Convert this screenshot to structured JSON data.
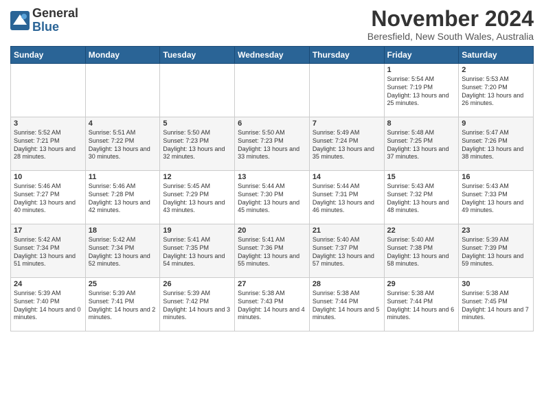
{
  "header": {
    "logo_general": "General",
    "logo_blue": "Blue",
    "month_title": "November 2024",
    "location": "Beresfield, New South Wales, Australia"
  },
  "weekdays": [
    "Sunday",
    "Monday",
    "Tuesday",
    "Wednesday",
    "Thursday",
    "Friday",
    "Saturday"
  ],
  "weeks": [
    [
      {
        "day": "",
        "content": ""
      },
      {
        "day": "",
        "content": ""
      },
      {
        "day": "",
        "content": ""
      },
      {
        "day": "",
        "content": ""
      },
      {
        "day": "",
        "content": ""
      },
      {
        "day": "1",
        "content": "Sunrise: 5:54 AM\nSunset: 7:19 PM\nDaylight: 13 hours and 25 minutes."
      },
      {
        "day": "2",
        "content": "Sunrise: 5:53 AM\nSunset: 7:20 PM\nDaylight: 13 hours and 26 minutes."
      }
    ],
    [
      {
        "day": "3",
        "content": "Sunrise: 5:52 AM\nSunset: 7:21 PM\nDaylight: 13 hours and 28 minutes."
      },
      {
        "day": "4",
        "content": "Sunrise: 5:51 AM\nSunset: 7:22 PM\nDaylight: 13 hours and 30 minutes."
      },
      {
        "day": "5",
        "content": "Sunrise: 5:50 AM\nSunset: 7:23 PM\nDaylight: 13 hours and 32 minutes."
      },
      {
        "day": "6",
        "content": "Sunrise: 5:50 AM\nSunset: 7:23 PM\nDaylight: 13 hours and 33 minutes."
      },
      {
        "day": "7",
        "content": "Sunrise: 5:49 AM\nSunset: 7:24 PM\nDaylight: 13 hours and 35 minutes."
      },
      {
        "day": "8",
        "content": "Sunrise: 5:48 AM\nSunset: 7:25 PM\nDaylight: 13 hours and 37 minutes."
      },
      {
        "day": "9",
        "content": "Sunrise: 5:47 AM\nSunset: 7:26 PM\nDaylight: 13 hours and 38 minutes."
      }
    ],
    [
      {
        "day": "10",
        "content": "Sunrise: 5:46 AM\nSunset: 7:27 PM\nDaylight: 13 hours and 40 minutes."
      },
      {
        "day": "11",
        "content": "Sunrise: 5:46 AM\nSunset: 7:28 PM\nDaylight: 13 hours and 42 minutes."
      },
      {
        "day": "12",
        "content": "Sunrise: 5:45 AM\nSunset: 7:29 PM\nDaylight: 13 hours and 43 minutes."
      },
      {
        "day": "13",
        "content": "Sunrise: 5:44 AM\nSunset: 7:30 PM\nDaylight: 13 hours and 45 minutes."
      },
      {
        "day": "14",
        "content": "Sunrise: 5:44 AM\nSunset: 7:31 PM\nDaylight: 13 hours and 46 minutes."
      },
      {
        "day": "15",
        "content": "Sunrise: 5:43 AM\nSunset: 7:32 PM\nDaylight: 13 hours and 48 minutes."
      },
      {
        "day": "16",
        "content": "Sunrise: 5:43 AM\nSunset: 7:33 PM\nDaylight: 13 hours and 49 minutes."
      }
    ],
    [
      {
        "day": "17",
        "content": "Sunrise: 5:42 AM\nSunset: 7:34 PM\nDaylight: 13 hours and 51 minutes."
      },
      {
        "day": "18",
        "content": "Sunrise: 5:42 AM\nSunset: 7:34 PM\nDaylight: 13 hours and 52 minutes."
      },
      {
        "day": "19",
        "content": "Sunrise: 5:41 AM\nSunset: 7:35 PM\nDaylight: 13 hours and 54 minutes."
      },
      {
        "day": "20",
        "content": "Sunrise: 5:41 AM\nSunset: 7:36 PM\nDaylight: 13 hours and 55 minutes."
      },
      {
        "day": "21",
        "content": "Sunrise: 5:40 AM\nSunset: 7:37 PM\nDaylight: 13 hours and 57 minutes."
      },
      {
        "day": "22",
        "content": "Sunrise: 5:40 AM\nSunset: 7:38 PM\nDaylight: 13 hours and 58 minutes."
      },
      {
        "day": "23",
        "content": "Sunrise: 5:39 AM\nSunset: 7:39 PM\nDaylight: 13 hours and 59 minutes."
      }
    ],
    [
      {
        "day": "24",
        "content": "Sunrise: 5:39 AM\nSunset: 7:40 PM\nDaylight: 14 hours and 0 minutes."
      },
      {
        "day": "25",
        "content": "Sunrise: 5:39 AM\nSunset: 7:41 PM\nDaylight: 14 hours and 2 minutes."
      },
      {
        "day": "26",
        "content": "Sunrise: 5:39 AM\nSunset: 7:42 PM\nDaylight: 14 hours and 3 minutes."
      },
      {
        "day": "27",
        "content": "Sunrise: 5:38 AM\nSunset: 7:43 PM\nDaylight: 14 hours and 4 minutes."
      },
      {
        "day": "28",
        "content": "Sunrise: 5:38 AM\nSunset: 7:44 PM\nDaylight: 14 hours and 5 minutes."
      },
      {
        "day": "29",
        "content": "Sunrise: 5:38 AM\nSunset: 7:44 PM\nDaylight: 14 hours and 6 minutes."
      },
      {
        "day": "30",
        "content": "Sunrise: 5:38 AM\nSunset: 7:45 PM\nDaylight: 14 hours and 7 minutes."
      }
    ]
  ]
}
